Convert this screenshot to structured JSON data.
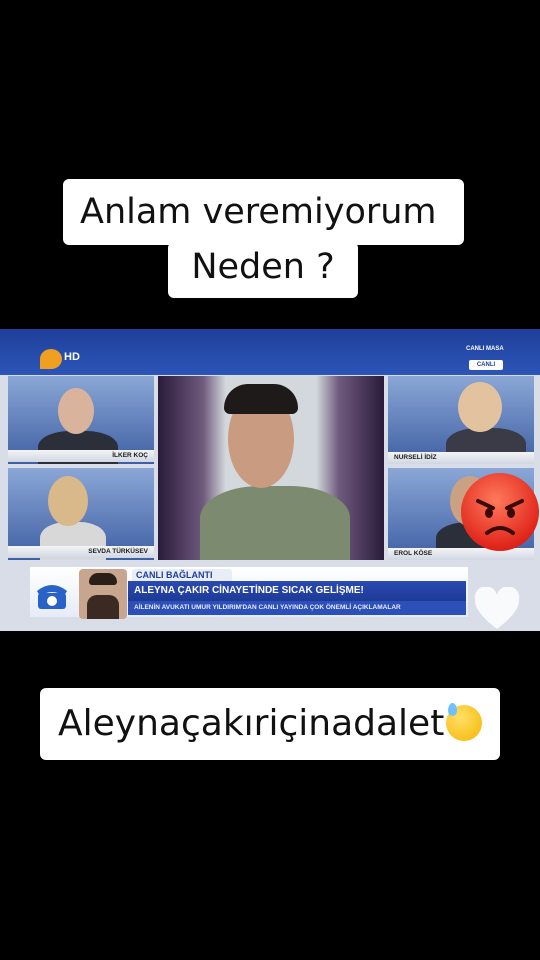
{
  "captions": {
    "line1": "Anlam veremiyorum",
    "line2": "Neden ?",
    "bottom": "Aleynaçakıriçinadalet"
  },
  "broadcast": {
    "channel_badge": "HD",
    "corner_label": "CANLI MASA",
    "live_badge": "CANLI",
    "guests": [
      "İLKER KOÇ",
      "NURSELİ İDİZ",
      "SEVDA TÜRKÜSEV",
      "EROL KÖSE"
    ],
    "live_connection": "CANLI BAĞLANTI",
    "headline": "ALEYNA ÇAKIR CİNAYETİNDE SICAK GELİŞME!",
    "subheadline": "AİLENİN AVUKATI UMUR YILDIRIM'DAN CANLI YAYINDA ÇOK ÖNEMLİ AÇIKLAMALAR"
  },
  "icons": {
    "overlay_emoji": "angry-face-icon",
    "caption_emoji": "downcast-sweat-face-icon",
    "phone": "telephone-icon",
    "heart": "heart-icon"
  },
  "colors": {
    "background": "#000000",
    "caption_bg": "#ffffff",
    "broadcast_blue": "#1f3f9a"
  }
}
